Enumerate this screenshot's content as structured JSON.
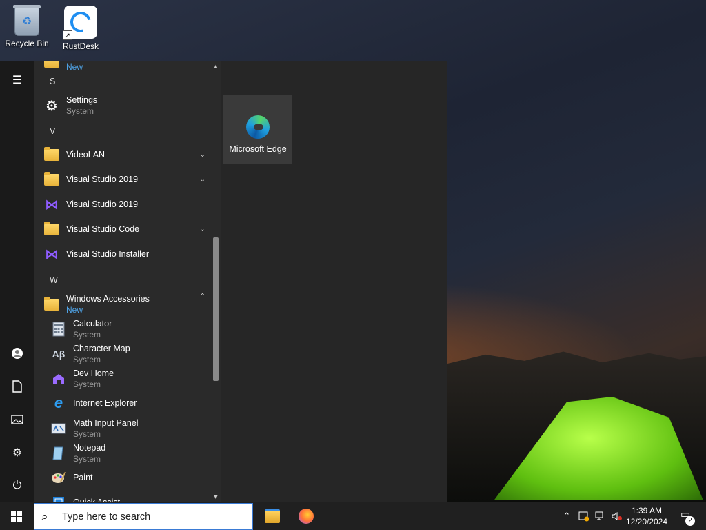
{
  "desktop": {
    "icons": [
      {
        "label": "Recycle Bin"
      },
      {
        "label": "RustDesk"
      }
    ]
  },
  "start_menu": {
    "rail": {
      "icons": [
        "menu-icon",
        "user-icon",
        "documents-icon",
        "pictures-icon",
        "settings-icon",
        "power-icon"
      ]
    },
    "app_list": {
      "partial_top_badge": "New",
      "letters": {
        "s": "S",
        "v": "V",
        "w": "W"
      },
      "settings": {
        "name": "Settings",
        "sub": "System"
      },
      "videolan": {
        "name": "VideoLAN"
      },
      "vs2019_folder": {
        "name": "Visual Studio 2019"
      },
      "vs2019_app": {
        "name": "Visual Studio 2019"
      },
      "vscode_folder": {
        "name": "Visual Studio Code"
      },
      "vs_installer": {
        "name": "Visual Studio Installer"
      },
      "win_accessories": {
        "name": "Windows Accessories",
        "badge": "New"
      },
      "calculator": {
        "name": "Calculator",
        "sub": "System"
      },
      "charmap": {
        "name": "Character Map",
        "sub": "System"
      },
      "devhome": {
        "name": "Dev Home",
        "sub": "System"
      },
      "ie": {
        "name": "Internet Explorer"
      },
      "mathinput": {
        "name": "Math Input Panel",
        "sub": "System"
      },
      "notepad": {
        "name": "Notepad",
        "sub": "System"
      },
      "paint": {
        "name": "Paint"
      },
      "quickassist": {
        "name": "Quick Assist"
      }
    },
    "tiles": [
      {
        "label": "Microsoft Edge"
      }
    ]
  },
  "taskbar": {
    "search_placeholder": "Type here to search",
    "pinned": [
      "File Explorer",
      "Firefox"
    ],
    "clock": {
      "time": "1:39 AM",
      "date": "12/20/2024"
    },
    "notifications_count": "2"
  }
}
